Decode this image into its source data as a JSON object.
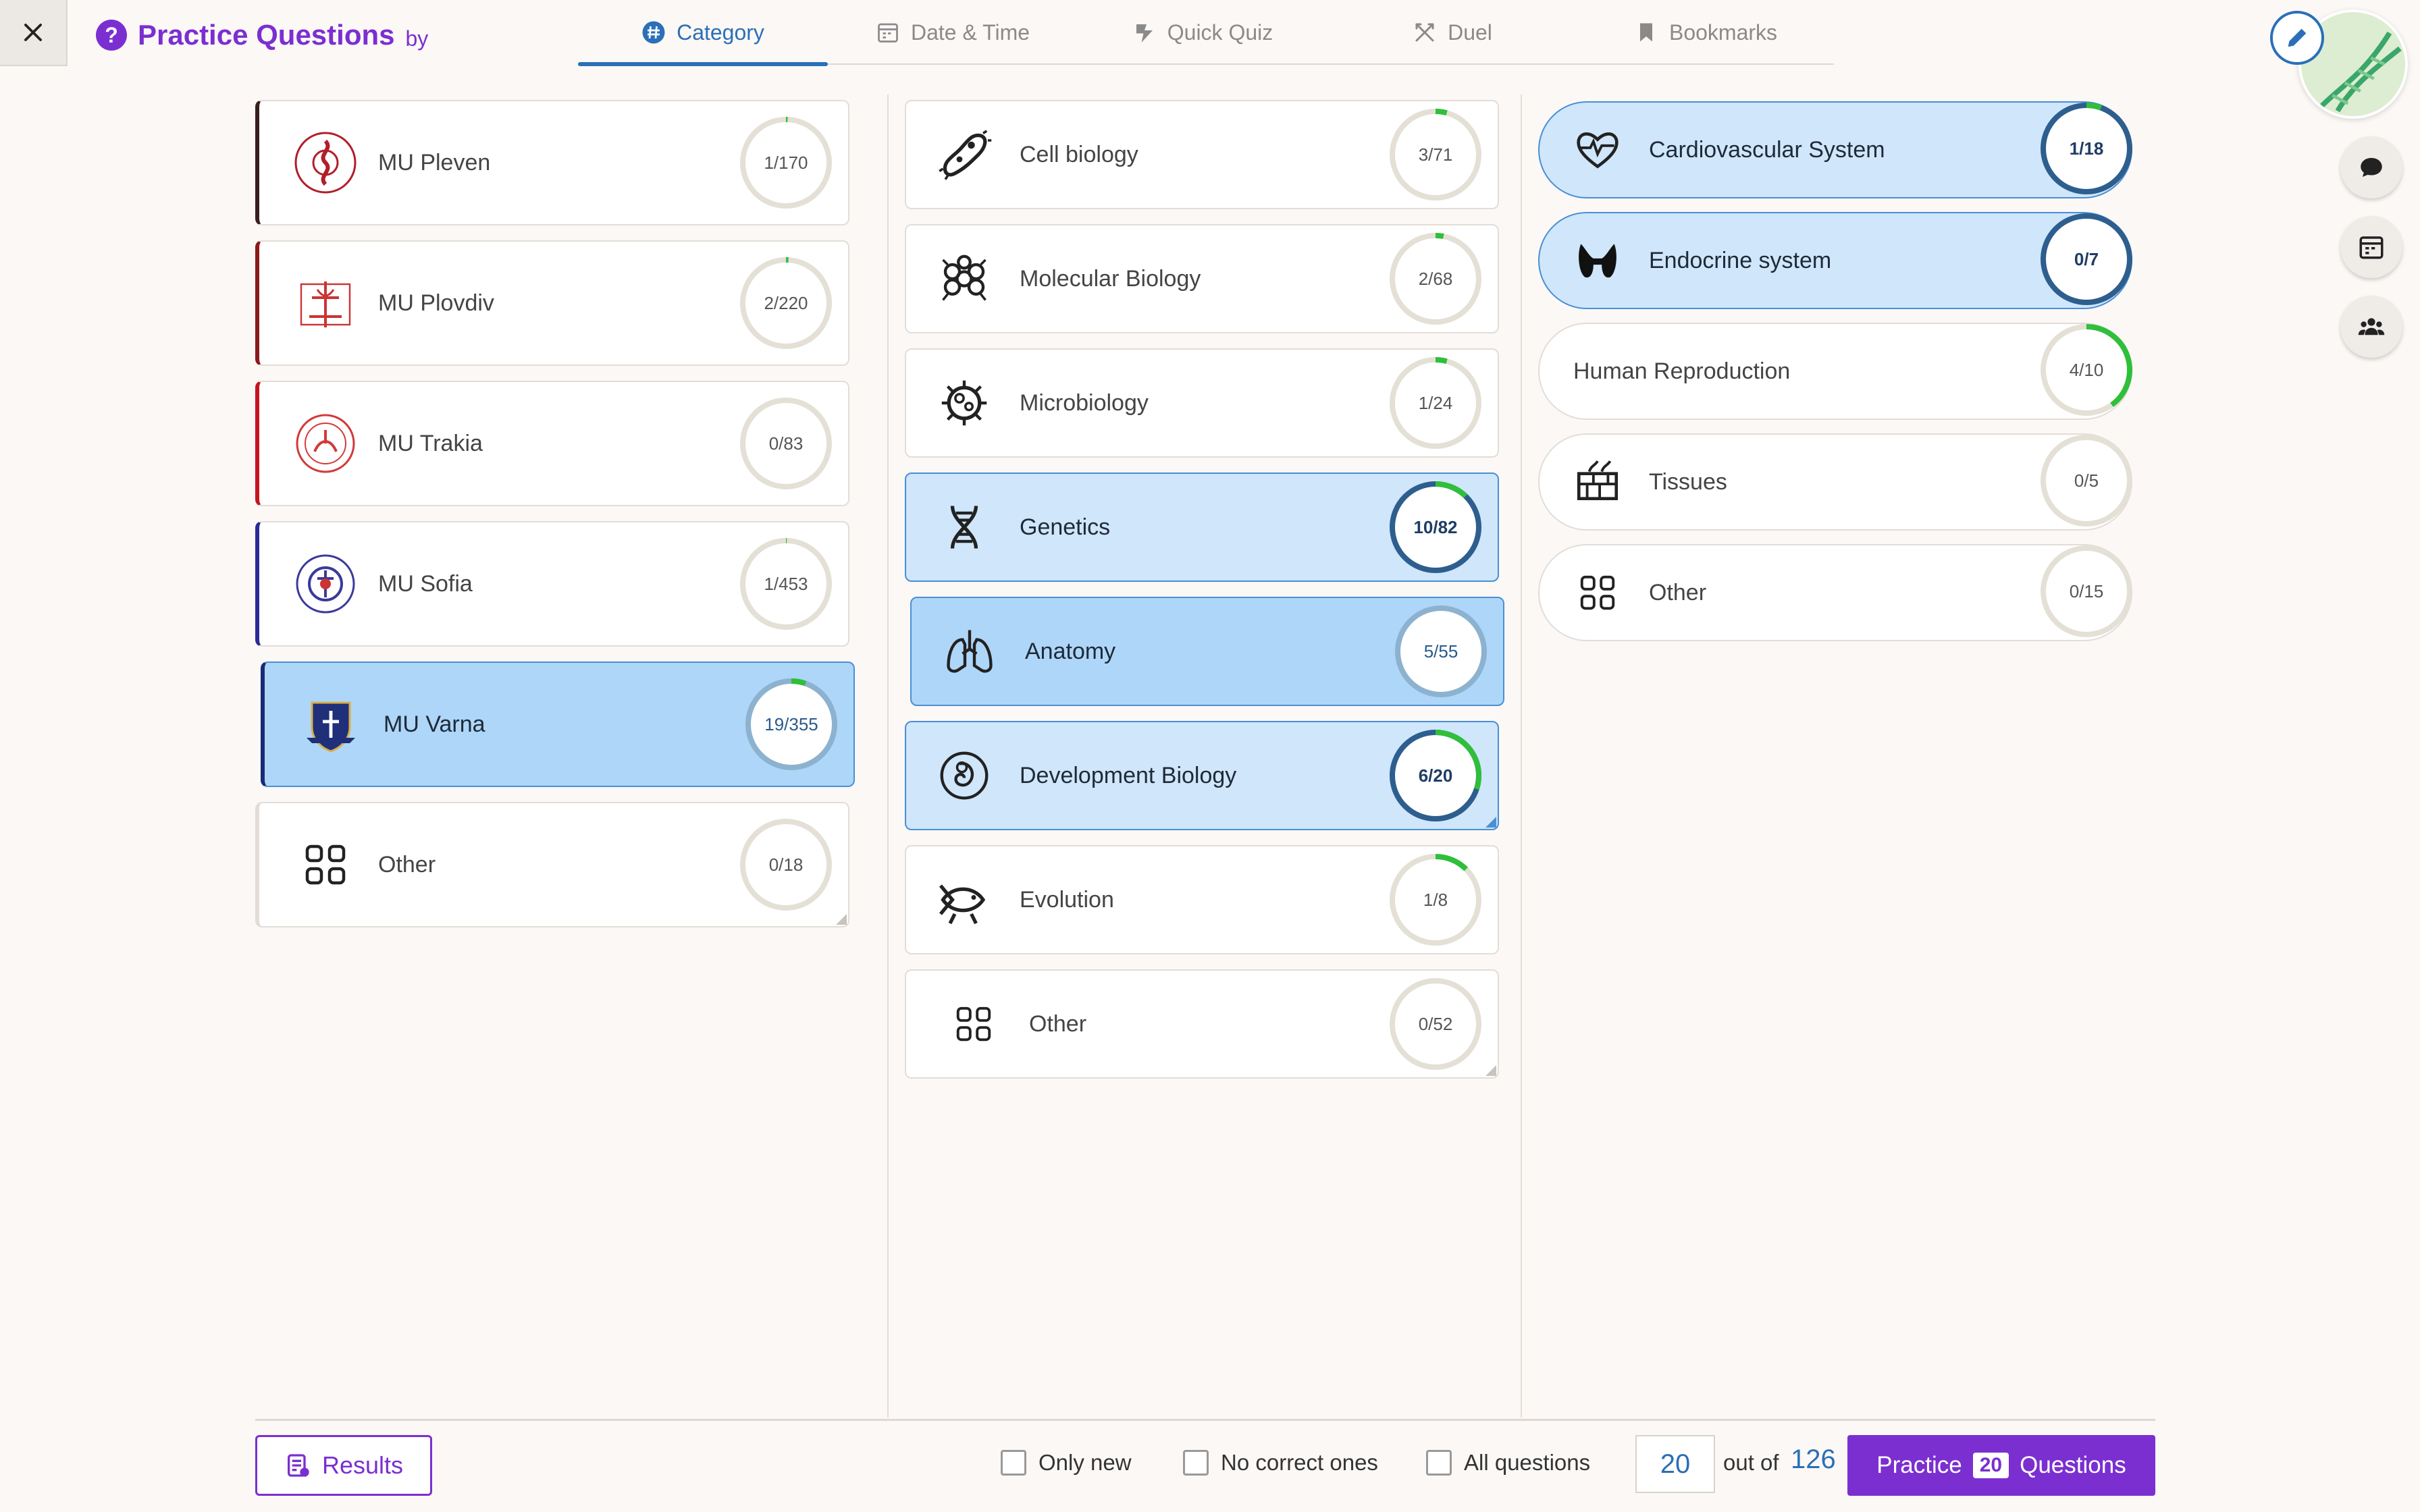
{
  "header": {
    "title": "Practice Questions",
    "title_suffix": "by",
    "tabs": [
      {
        "label": "Category",
        "icon": "hash-icon",
        "active": true
      },
      {
        "label": "Date & Time",
        "icon": "calendar-icon",
        "active": false
      },
      {
        "label": "Quick Quiz",
        "icon": "lightning-icon",
        "active": false
      },
      {
        "label": "Duel",
        "icon": "swords-icon",
        "active": false
      },
      {
        "label": "Bookmarks",
        "icon": "bookmark-icon",
        "active": false
      }
    ]
  },
  "universities": [
    {
      "label": "MU Pleven",
      "progress": "1/170",
      "accent": "#3a1f1f",
      "selected": false
    },
    {
      "label": "MU Plovdiv",
      "progress": "2/220",
      "accent": "#8b1a1a",
      "selected": false
    },
    {
      "label": "MU Trakia",
      "progress": "0/83",
      "accent": "#c4161c",
      "selected": false
    },
    {
      "label": "MU Sofia",
      "progress": "1/453",
      "accent": "#2a2a9a",
      "selected": false
    },
    {
      "label": "MU Varna",
      "progress": "19/355",
      "accent": "#1a2a7a",
      "selected": true
    },
    {
      "label": "Other",
      "progress": "0/18",
      "accent": "#e2ddd7",
      "selected": false
    }
  ],
  "subjects": [
    {
      "label": "Cell biology",
      "icon": "cell-icon",
      "progress": "3/71",
      "selected": false
    },
    {
      "label": "Molecular Biology",
      "icon": "molecule-icon",
      "progress": "2/68",
      "selected": false
    },
    {
      "label": "Microbiology",
      "icon": "microbe-icon",
      "progress": "1/24",
      "selected": false
    },
    {
      "label": "Genetics",
      "icon": "dna-icon",
      "progress": "10/82",
      "selected": true
    },
    {
      "label": "Anatomy",
      "icon": "lungs-icon",
      "progress": "5/55",
      "selected": true
    },
    {
      "label": "Development Biology",
      "icon": "embryo-icon",
      "progress": "6/20",
      "selected": true
    },
    {
      "label": "Evolution",
      "icon": "fish-icon",
      "progress": "1/8",
      "selected": false
    },
    {
      "label": "Other",
      "icon": "grid-icon",
      "progress": "0/52",
      "selected": false
    }
  ],
  "systems": [
    {
      "label": "Cardiovascular System",
      "icon": "heart-icon",
      "progress": "1/18",
      "selected": true
    },
    {
      "label": "Endocrine system",
      "icon": "thyroid-icon",
      "progress": "0/7",
      "selected": true
    },
    {
      "label": "Human Reproduction",
      "icon": "",
      "progress": "4/10",
      "selected": false
    },
    {
      "label": "Tissues",
      "icon": "tissue-icon",
      "progress": "0/5",
      "selected": false
    },
    {
      "label": "Other",
      "icon": "grid-icon",
      "progress": "0/15",
      "selected": false
    }
  ],
  "footer": {
    "results_label": "Results",
    "only_new": "Only new",
    "no_correct": "No correct ones",
    "all_questions": "All questions",
    "count": "20",
    "out_of": "out of",
    "total": "126",
    "practice_label": "Practice",
    "practice_count": "20",
    "questions_label": "Questions"
  },
  "colors": {
    "brand": "#7b2fd0",
    "accent_blue": "#2a6fb8",
    "progress_green": "#2fbf3a",
    "selected_bg": "#aed6f8"
  }
}
